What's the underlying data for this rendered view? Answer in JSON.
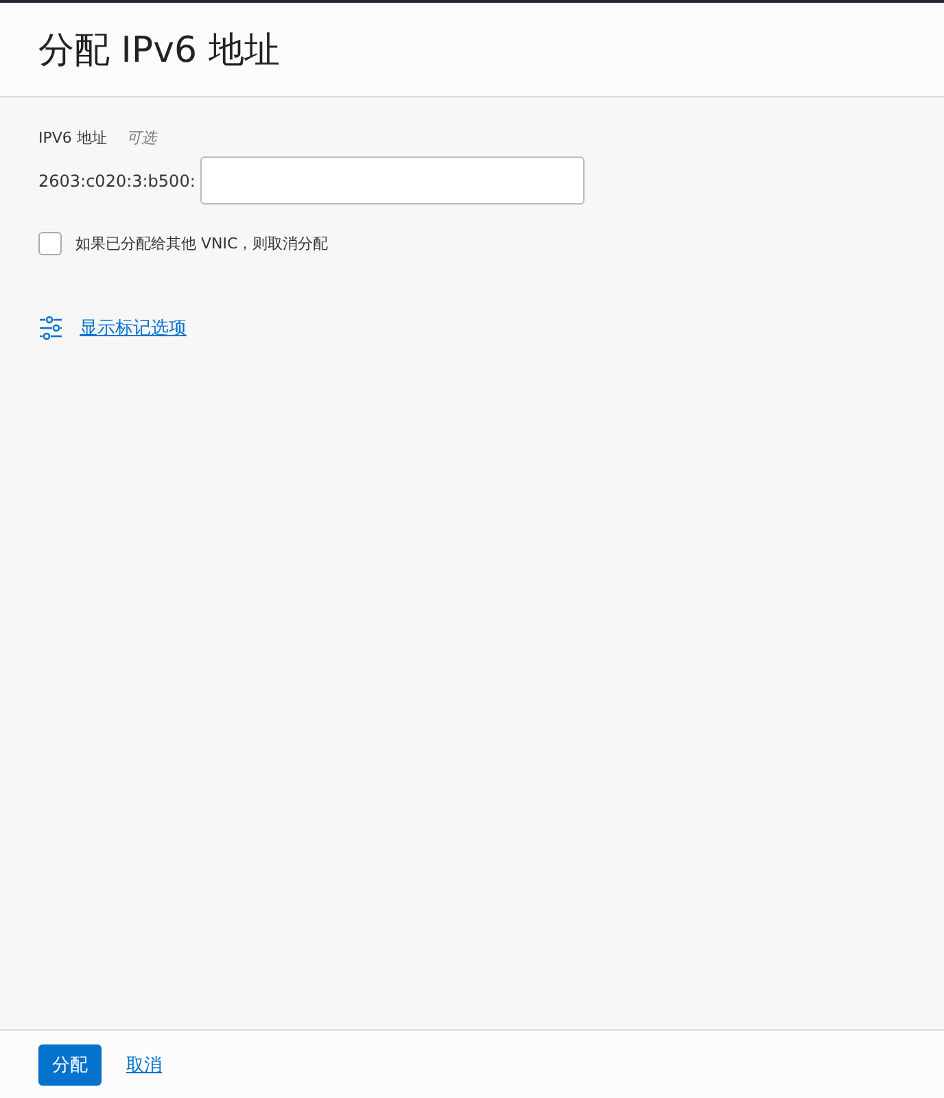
{
  "header": {
    "title": "分配 IPv6 地址"
  },
  "field": {
    "label": "IPV6 地址",
    "hint": "可选",
    "prefix": "2603:c020:3:b500:"
  },
  "checkbox": {
    "label": "如果已分配给其他 VNIC，则取消分配",
    "checked": false
  },
  "tags_link": {
    "label": "显示标记选项"
  },
  "footer": {
    "buttons": [
      {
        "label": "分配",
        "kind": "primary"
      },
      {
        "label": "取消",
        "kind": "link"
      }
    ]
  }
}
